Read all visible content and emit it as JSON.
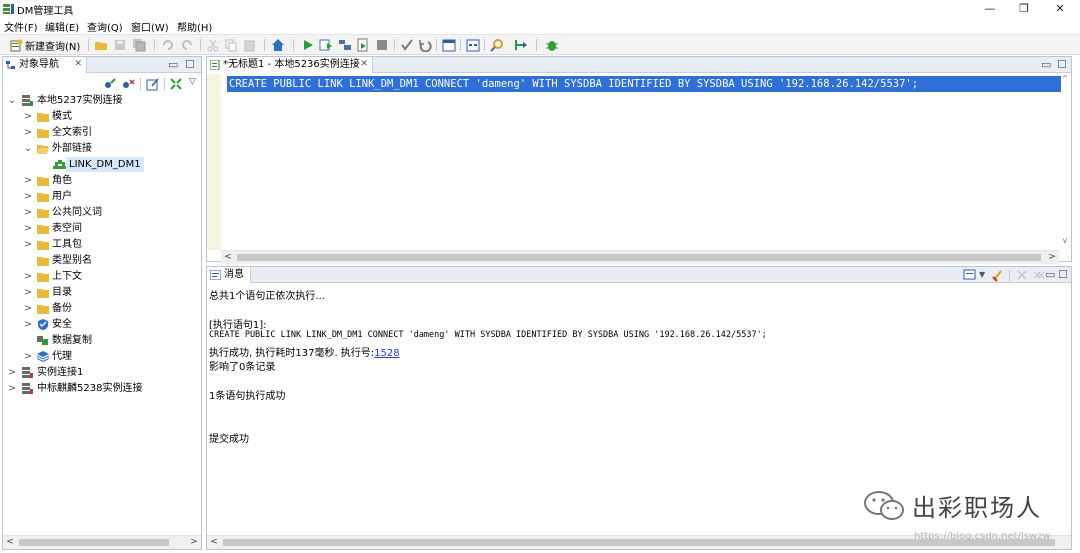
{
  "window": {
    "title": "DM管理工具",
    "minimize": "—",
    "maximize": "❐",
    "close": "✕"
  },
  "menu": [
    "文件(F)",
    "编辑(E)",
    "查询(Q)",
    "窗口(W)",
    "帮助(H)"
  ],
  "toolbar": {
    "new_query_label": "新建查询(N)"
  },
  "navigator": {
    "tab_label": "对象导航",
    "tab_close": "✕",
    "minimize": "▭",
    "maximize": "☐",
    "view_menu": "▽",
    "tree": {
      "root": "本地5237实例连接",
      "children": [
        "模式",
        "全文索引",
        "外部链接",
        "LINK_DM_DM1",
        "角色",
        "用户",
        "公共同义词",
        "表空间",
        "工具包",
        "类型别名",
        "上下文",
        "目录",
        "备份",
        "安全",
        "数据复制",
        "代理"
      ],
      "other_connections": [
        "实例连接1",
        "中标麒麟5238实例连接"
      ]
    }
  },
  "editor": {
    "tab_label": "*无标题1 - 本地5236实例连接",
    "tab_close": "✕",
    "minimize": "▭",
    "maximize": "☐",
    "code": "CREATE PUBLIC LINK LINK_DM_DM1 CONNECT 'dameng' WITH SYSDBA IDENTIFIED BY SYSDBA USING '192.168.26.142/5537';"
  },
  "messages": {
    "tab_label": "消息",
    "minimize": "▭",
    "maximize": "☐",
    "lines": {
      "line1": "总共1个语句正依次执行...",
      "line2": "[执行语句1]:",
      "line3": "CREATE PUBLIC LINK LINK_DM_DM1 CONNECT 'dameng' WITH SYSDBA IDENTIFIED BY SYSDBA USING '192.168.26.142/5537';",
      "line4_prefix": "执行成功, 执行耗时137毫秒. 执行号:",
      "line4_exec_no": "1528",
      "line5": "影响了0条记录",
      "line6": "1条语句执行成功",
      "line7": "提交成功"
    }
  },
  "watermark": {
    "text": "出彩职场人",
    "url": "https://blog.csdn.net/lswzw"
  },
  "scroll": {
    "left": "<",
    "right": ">",
    "up": "^",
    "down": "v"
  },
  "colors": {
    "selection": "#2f6fd8",
    "link": "#2a3bbf",
    "folder": "#e9b93b"
  }
}
